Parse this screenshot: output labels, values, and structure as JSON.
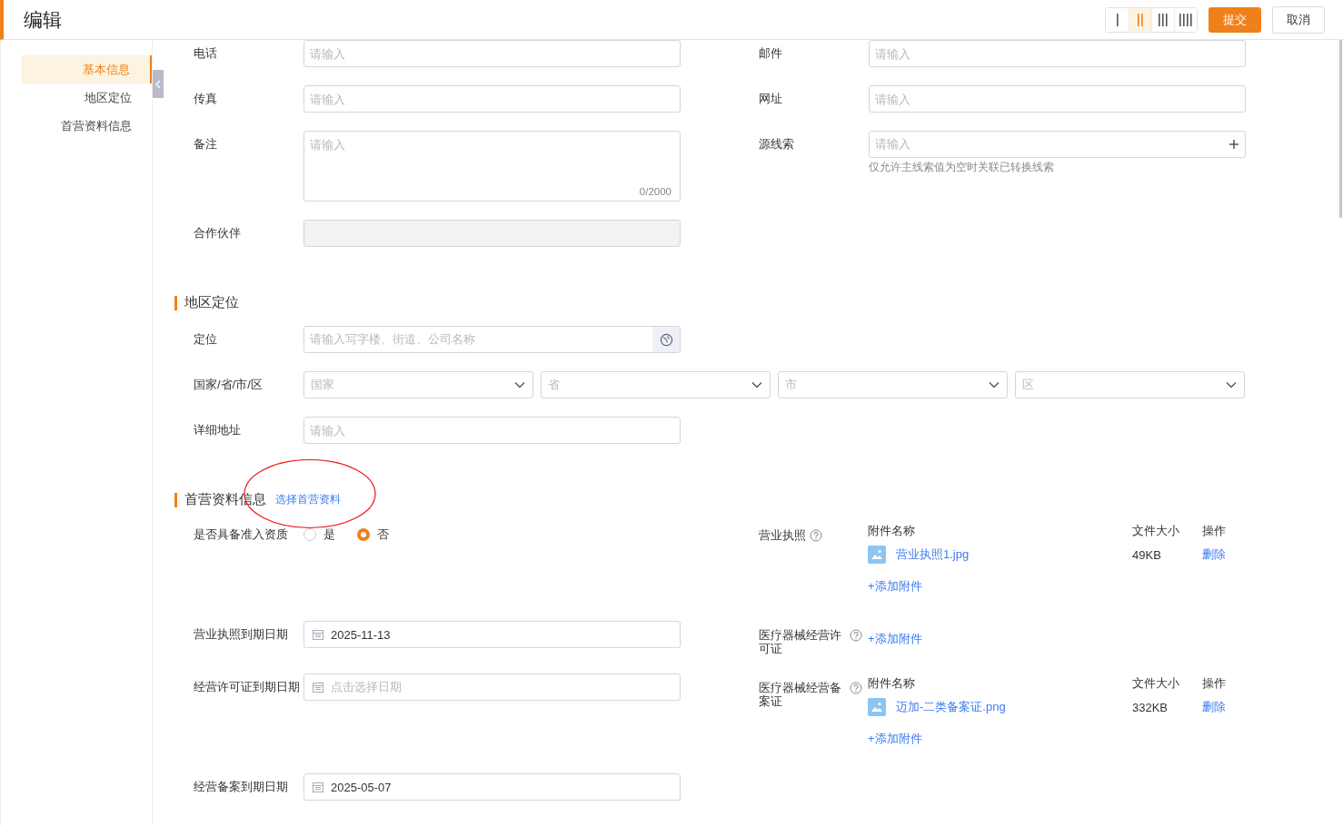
{
  "header": {
    "title": "编辑",
    "layout_toggle": [
      {
        "selected": false
      },
      {
        "selected": true
      },
      {
        "selected": false
      },
      {
        "selected": false
      }
    ],
    "submit": "提交",
    "cancel": "取消"
  },
  "sidebar": {
    "items": [
      {
        "label": "基本信息",
        "selected": true
      },
      {
        "label": "地区定位",
        "selected": false
      },
      {
        "label": "首营资料信息",
        "selected": false
      }
    ]
  },
  "basic_info": {
    "fields": [
      {
        "kind": "input",
        "label": "电话",
        "placeholder": "请输入"
      },
      {
        "kind": "input",
        "label": "邮件",
        "placeholder": "请输入"
      },
      {
        "kind": "input",
        "label": "传真",
        "placeholder": "请输入"
      },
      {
        "kind": "input",
        "label": "网址",
        "placeholder": "请输入"
      },
      {
        "kind": "textarea",
        "label": "备注",
        "placeholder": "请输入",
        "counter": "0/2000"
      },
      {
        "kind": "add_input",
        "label": "源线索",
        "placeholder": "请输入",
        "hint": "仅允许主线索值为空时关联已转换线索"
      },
      {
        "kind": "disabled",
        "label": "合作伙伴"
      }
    ]
  },
  "region": {
    "title": "地区定位",
    "fields": [
      {
        "kind": "location",
        "label": "定位",
        "placeholder": "请输入写字楼、街道、公司名称"
      },
      {
        "kind": "selects",
        "label": "国家/省/市/区",
        "placeholders": [
          "国家",
          "省",
          "市",
          "区"
        ]
      },
      {
        "kind": "input",
        "label": "详细地址",
        "placeholder": "请输入"
      }
    ]
  },
  "qualification": {
    "title": "首营资料信息",
    "link": "选择首营资料",
    "rows": [
      {
        "left": {
          "kind": "radio",
          "label": "是否具备准入资质",
          "options": [
            {
              "label": "是",
              "selected": false
            },
            {
              "label": "否",
              "selected": true
            }
          ]
        },
        "right": {
          "kind": "attachments",
          "label": "营业执照",
          "columns": [
            "附件名称",
            "文件大小",
            "操作"
          ],
          "files": [
            {
              "name": "营业执照1.jpg",
              "size": "49KB",
              "action": "删除"
            }
          ],
          "add": "+添加附件"
        }
      },
      {
        "left": {
          "kind": "date",
          "label": "营业执照到期日期",
          "value": "2025-11-13"
        },
        "right": {
          "kind": "attachments",
          "label": "医疗器械经营许可证",
          "add": "+添加附件"
        }
      },
      {
        "left": {
          "kind": "date",
          "label": "经营许可证到期日期",
          "placeholder": "点击选择日期"
        },
        "right": {
          "kind": "attachments",
          "label": "医疗器械经营备案证",
          "columns": [
            "附件名称",
            "文件大小",
            "操作"
          ],
          "files": [
            {
              "name": "迈加-二类备案证.png",
              "size": "332KB",
              "action": "删除"
            }
          ],
          "add": "+添加附件"
        }
      },
      {
        "left": {
          "kind": "date",
          "label": "经营备案到期日期",
          "value": "2025-05-07"
        }
      }
    ]
  }
}
